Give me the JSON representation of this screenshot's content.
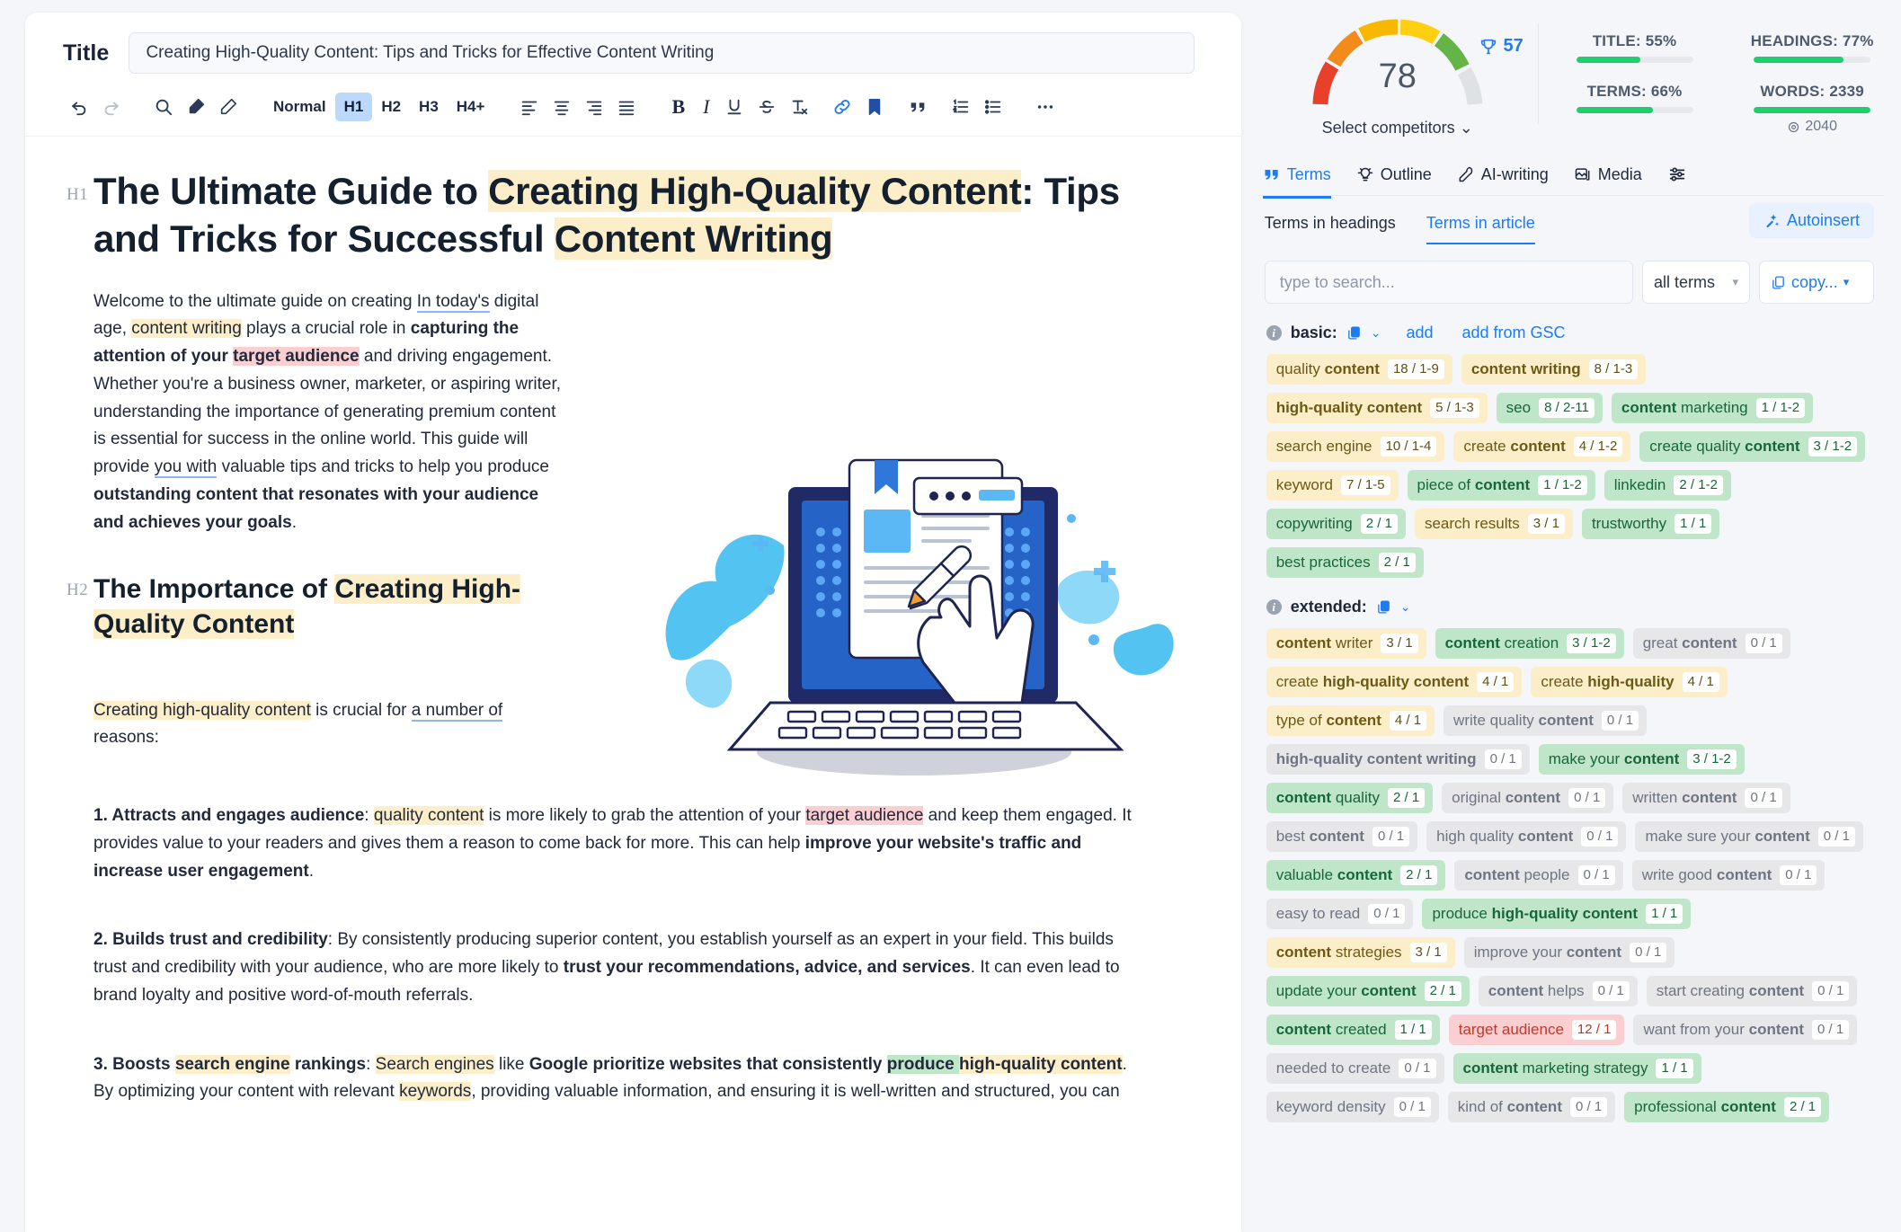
{
  "editor": {
    "title_label": "Title",
    "title_value": "Creating High-Quality Content: Tips and Tricks for Effective Content Writing",
    "toolbar": {
      "undo": "undo-icon",
      "redo": "redo-icon",
      "search": "search-icon",
      "highlighter": "marker-icon",
      "pen": "pen-icon",
      "styles": [
        "Normal",
        "H1",
        "H2",
        "H3",
        "H4+"
      ],
      "active_style": "H1",
      "align": [
        "align-left",
        "align-center",
        "align-right",
        "align-justify"
      ],
      "format": [
        "B",
        "I",
        "U",
        "S",
        "Tx"
      ],
      "link": "link-icon",
      "bookmark": "bookmark-icon",
      "quote": "quote-icon",
      "ordered_list": "ordered-list-icon",
      "bullet_list": "bullet-list-icon",
      "more": "more-icon"
    },
    "doc": {
      "h1_tag": "H1",
      "h1_parts": [
        {
          "t": "The Ultimate Guide to ",
          "hl": ""
        },
        {
          "t": "Creating High-Quality Content",
          "hl": "y"
        },
        {
          "t": ": Tips and Tricks for Successful ",
          "hl": ""
        },
        {
          "t": "Content Writing",
          "hl": "y"
        }
      ],
      "p1_parts": [
        {
          "t": "Welcome to the ultimate guide on creating  ",
          "hl": ""
        },
        {
          "t": "In today's",
          "hl": "u"
        },
        {
          "t": " digital age, ",
          "hl": ""
        },
        {
          "t": "content writing",
          "hl": "y"
        },
        {
          "t": " plays a crucial role in ",
          "hl": ""
        },
        {
          "t": "capturing the attention of your ",
          "hl": "b"
        },
        {
          "t": "target audience",
          "hl": "rb"
        },
        {
          "t": " and driving engagement. Whether you're a business owner, marketer, or aspiring writer, understanding the importance of generating premium content is essential for success in the online world. This guide will provide ",
          "hl": ""
        },
        {
          "t": "you with",
          "hl": "u"
        },
        {
          "t": " valuable tips and tricks to help you produce ",
          "hl": ""
        },
        {
          "t": "outstanding content that resonates with your audience and achieves your goals",
          "hl": "b"
        },
        {
          "t": ".",
          "hl": ""
        }
      ],
      "h2_tag": "H2",
      "h2_parts": [
        {
          "t": "The Importance of ",
          "hl": ""
        },
        {
          "t": "Creating High-Quality Content",
          "hl": "y"
        }
      ],
      "p2_parts": [
        {
          "t": "Creating high-quality content",
          "hl": "y"
        },
        {
          "t": " is crucial for ",
          "hl": ""
        },
        {
          "t": "a number of",
          "hl": "u"
        },
        {
          "t": " reasons:",
          "hl": ""
        }
      ],
      "p3_parts": [
        {
          "t": "1. Attracts and engages audience",
          "hl": "b"
        },
        {
          "t": ": ",
          "hl": ""
        },
        {
          "t": "quality content",
          "hl": "y"
        },
        {
          "t": " is more likely to grab the attention of your ",
          "hl": ""
        },
        {
          "t": "target audience",
          "hl": "r"
        },
        {
          "t": " and keep them engaged. It provides value to your readers and gives them a reason to come back for more. This can help ",
          "hl": ""
        },
        {
          "t": "improve your website's traffic and increase user engagement",
          "hl": "b"
        },
        {
          "t": ".",
          "hl": ""
        }
      ],
      "p4_parts": [
        {
          "t": "2. Builds trust and credibility",
          "hl": "b"
        },
        {
          "t": ": By consistently producing superior content, you establish yourself as an expert in your field. This builds trust and credibility with your audience, who are more likely to ",
          "hl": ""
        },
        {
          "t": "trust your recommendations, advice, and services",
          "hl": "b"
        },
        {
          "t": ". It can even lead to brand loyalty and positive word-of-mouth referrals.",
          "hl": ""
        }
      ],
      "p5_parts": [
        {
          "t": "3. Boosts ",
          "hl": "b"
        },
        {
          "t": "search engine",
          "hl": "yb"
        },
        {
          "t": " rankings",
          "hl": "b"
        },
        {
          "t": ": ",
          "hl": ""
        },
        {
          "t": "Search engines",
          "hl": "y"
        },
        {
          "t": " like ",
          "hl": ""
        },
        {
          "t": "Google prioritize websites that consistently ",
          "hl": "b"
        },
        {
          "t": "produce ",
          "hl": "gb"
        },
        {
          "t": "high-quality content",
          "hl": "yb"
        },
        {
          "t": ". By optimizing your content with relevant ",
          "hl": ""
        },
        {
          "t": "keywords",
          "hl": "y"
        },
        {
          "t": ", providing valuable information, and ensuring it is well-written and structured, you can",
          "hl": ""
        }
      ]
    }
  },
  "panel": {
    "score": "78",
    "trophy_value": "57",
    "select_competitors": "Select competitors",
    "metrics": [
      {
        "label": "TITLE: 55%",
        "pct": 55
      },
      {
        "label": "HEADINGS: 77%",
        "pct": 77
      },
      {
        "label": "TERMS: 66%",
        "pct": 66
      },
      {
        "label": "WORDS: 2339",
        "pct": 100,
        "sub": "2040"
      }
    ],
    "tabs": [
      {
        "label": "Terms",
        "icon": "quotes-icon",
        "active": true
      },
      {
        "label": "Outline",
        "icon": "bulb-icon",
        "active": false
      },
      {
        "label": "AI-writing",
        "icon": "pen-nib-icon",
        "active": false
      },
      {
        "label": "Media",
        "icon": "image-icon",
        "active": false
      }
    ],
    "settings_icon": "sliders-icon",
    "subtabs": [
      {
        "label": "Terms in headings",
        "active": false
      },
      {
        "label": "Terms in article",
        "active": true
      }
    ],
    "autoinsert_label": "Autoinsert",
    "search_placeholder": "type to search...",
    "select_value": "all terms",
    "copy_label": "copy...",
    "groups": [
      {
        "name": "basic:",
        "links": [
          "add",
          "add from GSC"
        ],
        "chips": [
          {
            "pre": "quality ",
            "bold": "content",
            "post": "",
            "cnt": "18 / 1-9",
            "c": "y"
          },
          {
            "pre": "",
            "bold": "content writing",
            "post": "",
            "cnt": "8 / 1-3",
            "c": "y"
          },
          {
            "pre": "",
            "bold": "high-quality content",
            "post": "",
            "cnt": "5 / 1-3",
            "c": "y"
          },
          {
            "pre": "seo",
            "bold": "",
            "post": "",
            "cnt": "8 / 2-11",
            "c": "g"
          },
          {
            "pre": "",
            "bold": "content",
            "post": " marketing",
            "cnt": "1 / 1-2",
            "c": "g"
          },
          {
            "pre": "search engine",
            "bold": "",
            "post": "",
            "cnt": "10 / 1-4",
            "c": "y"
          },
          {
            "pre": "create ",
            "bold": "content",
            "post": "",
            "cnt": "4 / 1-2",
            "c": "y"
          },
          {
            "pre": "create quality ",
            "bold": "content",
            "post": "",
            "cnt": "3 / 1-2",
            "c": "g"
          },
          {
            "pre": "keyword",
            "bold": "",
            "post": "",
            "cnt": "7 / 1-5",
            "c": "y"
          },
          {
            "pre": "piece of ",
            "bold": "content",
            "post": "",
            "cnt": "1 / 1-2",
            "c": "g"
          },
          {
            "pre": "linkedin",
            "bold": "",
            "post": "",
            "cnt": "2 / 1-2",
            "c": "g"
          },
          {
            "pre": "copywriting",
            "bold": "",
            "post": "",
            "cnt": "2 / 1",
            "c": "g"
          },
          {
            "pre": "search results",
            "bold": "",
            "post": "",
            "cnt": "3 / 1",
            "c": "y"
          },
          {
            "pre": "trustworthy",
            "bold": "",
            "post": "",
            "cnt": "1 / 1",
            "c": "g"
          },
          {
            "pre": "best practices",
            "bold": "",
            "post": "",
            "cnt": "2 / 1",
            "c": "g"
          }
        ]
      },
      {
        "name": "extended:",
        "links": [],
        "chips": [
          {
            "pre": "",
            "bold": "content",
            "post": " writer",
            "cnt": "3 / 1",
            "c": "y"
          },
          {
            "pre": "",
            "bold": "content",
            "post": " creation",
            "cnt": "3 / 1-2",
            "c": "g"
          },
          {
            "pre": "great ",
            "bold": "content",
            "post": "",
            "cnt": "0 / 1",
            "c": "n"
          },
          {
            "pre": "create ",
            "bold": "high-quality content",
            "post": "",
            "cnt": "4 / 1",
            "c": "y"
          },
          {
            "pre": "create ",
            "bold": "high-quality",
            "post": "",
            "cnt": "4 / 1",
            "c": "y"
          },
          {
            "pre": "type of ",
            "bold": "content",
            "post": "",
            "cnt": "4 / 1",
            "c": "y"
          },
          {
            "pre": "write quality ",
            "bold": "content",
            "post": "",
            "cnt": "0 / 1",
            "c": "n"
          },
          {
            "pre": "",
            "bold": "high-quality content writing",
            "post": "",
            "cnt": "0 / 1",
            "c": "n"
          },
          {
            "pre": "make your ",
            "bold": "content",
            "post": "",
            "cnt": "3 / 1-2",
            "c": "g"
          },
          {
            "pre": "",
            "bold": "content",
            "post": " quality",
            "cnt": "2 / 1",
            "c": "g"
          },
          {
            "pre": "original ",
            "bold": "content",
            "post": "",
            "cnt": "0 / 1",
            "c": "n"
          },
          {
            "pre": "written ",
            "bold": "content",
            "post": "",
            "cnt": "0 / 1",
            "c": "n"
          },
          {
            "pre": "best ",
            "bold": "content",
            "post": "",
            "cnt": "0 / 1",
            "c": "n"
          },
          {
            "pre": "high quality ",
            "bold": "content",
            "post": "",
            "cnt": "0 / 1",
            "c": "n"
          },
          {
            "pre": "make sure your ",
            "bold": "content",
            "post": "",
            "cnt": "0 / 1",
            "c": "n"
          },
          {
            "pre": "valuable ",
            "bold": "content",
            "post": "",
            "cnt": "2 / 1",
            "c": "g"
          },
          {
            "pre": "",
            "bold": "content",
            "post": " people",
            "cnt": "0 / 1",
            "c": "n"
          },
          {
            "pre": "write good ",
            "bold": "content",
            "post": "",
            "cnt": "0 / 1",
            "c": "n"
          },
          {
            "pre": "easy to read",
            "bold": "",
            "post": "",
            "cnt": "0 / 1",
            "c": "n"
          },
          {
            "pre": "produce ",
            "bold": "high-quality content",
            "post": "",
            "cnt": "1 / 1",
            "c": "g"
          },
          {
            "pre": "",
            "bold": "content",
            "post": " strategies",
            "cnt": "3 / 1",
            "c": "y"
          },
          {
            "pre": "improve your ",
            "bold": "content",
            "post": "",
            "cnt": "0 / 1",
            "c": "n"
          },
          {
            "pre": "update your ",
            "bold": "content",
            "post": "",
            "cnt": "2 / 1",
            "c": "g"
          },
          {
            "pre": "",
            "bold": "content",
            "post": " helps",
            "cnt": "0 / 1",
            "c": "n"
          },
          {
            "pre": "start creating ",
            "bold": "content",
            "post": "",
            "cnt": "0 / 1",
            "c": "n"
          },
          {
            "pre": "",
            "bold": "content",
            "post": " created",
            "cnt": "1 / 1",
            "c": "g"
          },
          {
            "pre": "target audience",
            "bold": "",
            "post": "",
            "cnt": "12 / 1",
            "c": "r"
          },
          {
            "pre": "want from your ",
            "bold": "content",
            "post": "",
            "cnt": "0 / 1",
            "c": "n"
          },
          {
            "pre": "needed to create",
            "bold": "",
            "post": "",
            "cnt": "0 / 1",
            "c": "n"
          },
          {
            "pre": "",
            "bold": "content",
            "post": " marketing strategy",
            "cnt": "1 / 1",
            "c": "g"
          },
          {
            "pre": "keyword density",
            "bold": "",
            "post": "",
            "cnt": "0 / 1",
            "c": "n"
          },
          {
            "pre": "kind of ",
            "bold": "content",
            "post": "",
            "cnt": "0 / 1",
            "c": "n"
          },
          {
            "pre": "professional ",
            "bold": "content",
            "post": "",
            "cnt": "2 / 1",
            "c": "g"
          }
        ]
      }
    ]
  }
}
